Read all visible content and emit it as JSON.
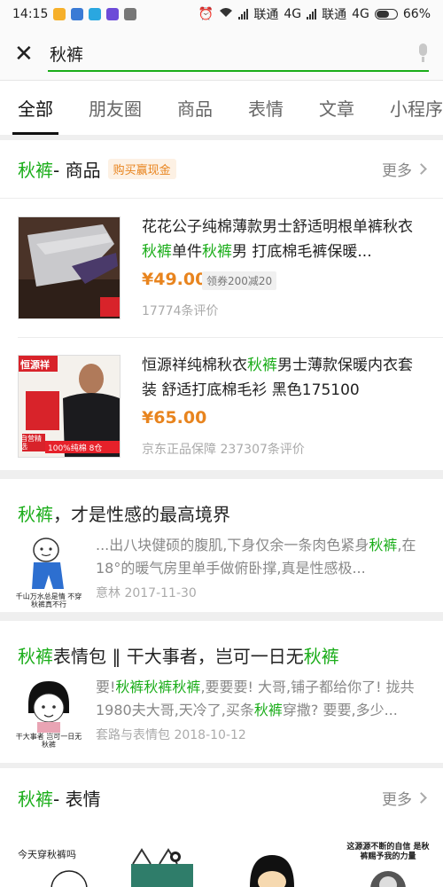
{
  "status": {
    "time": "14:15",
    "carrier1": "联通",
    "net1": "4G",
    "carrier2": "联通",
    "net2": "4G",
    "battery": "66%"
  },
  "search": {
    "query": "秋裤"
  },
  "tabs": [
    {
      "label": "全部"
    },
    {
      "label": "朋友圈"
    },
    {
      "label": "商品"
    },
    {
      "label": "表情"
    },
    {
      "label": "文章"
    },
    {
      "label": "小程序"
    }
  ],
  "products_section": {
    "keyword": "秋裤",
    "suffix": " - 商品",
    "badge": "购买赢现金",
    "more": "更多",
    "items": [
      {
        "title_a": "花花公子纯棉薄款男士舒适明根单裤秋衣",
        "title_b": "秋裤",
        "title_c": "单件",
        "title_d": "秋裤",
        "title_e": "男 打底棉毛裤保暖...",
        "price": "¥49.00",
        "coupon": "领券200减20",
        "meta": "17774条评价"
      },
      {
        "title_a": "恒源祥纯棉秋衣",
        "title_b": "秋裤",
        "title_c": "男士薄款保暖内衣套装 舒适打底棉毛衫 黑色175100",
        "price": "¥65.00",
        "meta": "京东正品保障  237307条评价",
        "img_brand": "恒源祥",
        "img_tag1": "自营精选",
        "img_tag2": "100%纯棉 8仓"
      }
    ]
  },
  "article1": {
    "title_kw": "秋裤",
    "title_rest": "，才是性感的最高境界",
    "text_a": "...出八块健硕的腹肌,下身仅余一条肉色紧身",
    "text_kw": "秋裤",
    "text_b": ",在18°的暖气房里单手做俯卧撑,真是性感极...",
    "meta": "意林  2017-11-30",
    "img_caption": "千山万水总是情 不穿秋裤真不行"
  },
  "article2": {
    "title_kw": "秋裤",
    "title_mid": "表情包 ‖ 干大事者，岂可一日无",
    "title_kw2": "秋裤",
    "text_a": "要!",
    "text_kw1": "秋裤秋裤秋裤",
    "text_b": ",要要要! 大哥,铺子都给你了! 拢共1980夫大哥,天冷了,买条",
    "text_kw2": "秋裤",
    "text_c": "穿撒? 要要,多少...",
    "meta": "套路与表情包  2018-10-12",
    "img_caption": "干大事者 岂可一日无秋裤"
  },
  "stickers_section": {
    "keyword": "秋裤",
    "suffix": " - 表情",
    "more": "更多",
    "sticker1_text": "今天穿秋裤吗",
    "sticker4_text": "这源源不断的自信 是秋裤赐予我的力量"
  }
}
